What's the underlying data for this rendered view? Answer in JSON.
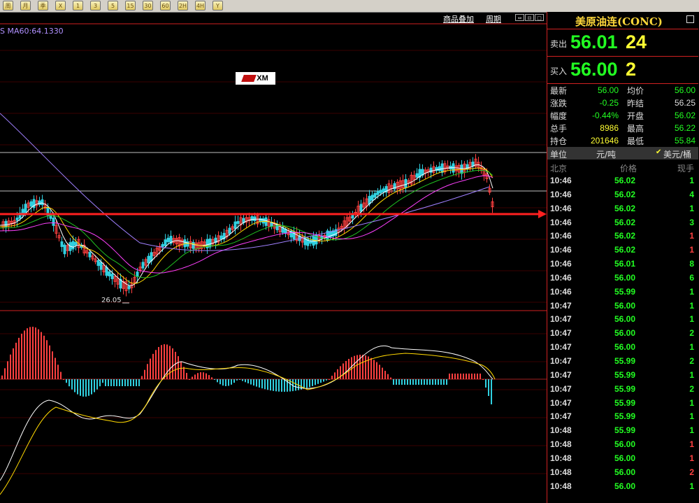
{
  "toolbar": {
    "buttons": [
      "周",
      "月",
      "季",
      "X",
      "1",
      "3",
      "5",
      "15",
      "30",
      "60",
      "2H",
      "4H",
      "Y"
    ]
  },
  "chart_menu": {
    "overlay_label": "商品叠加",
    "period_label": "周期"
  },
  "indicator": {
    "ma_label": "S  MA60:64.1330"
  },
  "logo": {
    "text": "XM"
  },
  "chart_data": {
    "type": "candlestick",
    "low_marker": "26.05",
    "annotation": "red arrow pointing right toward price panel",
    "colors": {
      "up": "#ff4040",
      "down": "#30d0e0",
      "ma_fast": "#ffffff",
      "ma_mid": "#ffd800",
      "ma_slow": "#ff40ff",
      "ma_60": "#a080ff",
      "macd_pos": "#ff4040",
      "macd_neg": "#30d0e0"
    }
  },
  "panel": {
    "title": "美原油连(CONC)",
    "sell_label": "卖出",
    "sell_price": "56.01",
    "sell_vol": "24",
    "buy_label": "买入",
    "buy_price": "56.00",
    "buy_vol": "2",
    "quote": [
      {
        "l1": "最新",
        "v1": "56.00",
        "c1": "green",
        "l2": "均价",
        "v2": "56.00",
        "c2": "green"
      },
      {
        "l1": "涨跌",
        "v1": "-0.25",
        "c1": "green",
        "l2": "昨结",
        "v2": "56.25",
        "c2": "white"
      },
      {
        "l1": "幅度",
        "v1": "-0.44%",
        "c1": "green",
        "l2": "开盘",
        "v2": "56.02",
        "c2": "green"
      },
      {
        "l1": "总手",
        "v1": "8986",
        "c1": "yellow",
        "l2": "最高",
        "v2": "56.22",
        "c2": "green"
      },
      {
        "l1": "持仓",
        "v1": "201646",
        "c1": "yellow",
        "l2": "最低",
        "v2": "55.84",
        "c2": "green"
      }
    ],
    "unit_label": "单位",
    "unit_cny": "元/吨",
    "unit_usd": "美元/桶",
    "tick_header": {
      "time": "北京",
      "price": "价格",
      "vol": "现手"
    },
    "ticks": [
      {
        "t": "10:46",
        "p": "56.02",
        "v": "1",
        "c": "green"
      },
      {
        "t": "10:46",
        "p": "56.02",
        "v": "4",
        "c": "green"
      },
      {
        "t": "10:46",
        "p": "56.02",
        "v": "1",
        "c": "green"
      },
      {
        "t": "10:46",
        "p": "56.02",
        "v": "3",
        "c": "green"
      },
      {
        "t": "10:46",
        "p": "56.02",
        "v": "1",
        "c": "red"
      },
      {
        "t": "10:46",
        "p": "56.02",
        "v": "1",
        "c": "red"
      },
      {
        "t": "10:46",
        "p": "56.01",
        "v": "8",
        "c": "green"
      },
      {
        "t": "10:46",
        "p": "56.00",
        "v": "6",
        "c": "green"
      },
      {
        "t": "10:46",
        "p": "55.99",
        "v": "1",
        "c": "green"
      },
      {
        "t": "10:47",
        "p": "56.00",
        "v": "1",
        "c": "green"
      },
      {
        "t": "10:47",
        "p": "56.00",
        "v": "1",
        "c": "green"
      },
      {
        "t": "10:47",
        "p": "56.00",
        "v": "2",
        "c": "green"
      },
      {
        "t": "10:47",
        "p": "56.00",
        "v": "1",
        "c": "green"
      },
      {
        "t": "10:47",
        "p": "55.99",
        "v": "2",
        "c": "green"
      },
      {
        "t": "10:47",
        "p": "55.99",
        "v": "1",
        "c": "green"
      },
      {
        "t": "10:47",
        "p": "55.99",
        "v": "2",
        "c": "green"
      },
      {
        "t": "10:47",
        "p": "55.99",
        "v": "1",
        "c": "green"
      },
      {
        "t": "10:47",
        "p": "55.99",
        "v": "1",
        "c": "green"
      },
      {
        "t": "10:48",
        "p": "55.99",
        "v": "1",
        "c": "green"
      },
      {
        "t": "10:48",
        "p": "56.00",
        "v": "1",
        "c": "red"
      },
      {
        "t": "10:48",
        "p": "56.00",
        "v": "1",
        "c": "red"
      },
      {
        "t": "10:48",
        "p": "56.00",
        "v": "2",
        "c": "red"
      },
      {
        "t": "10:48",
        "p": "56.00",
        "v": "1",
        "c": "green"
      }
    ]
  }
}
